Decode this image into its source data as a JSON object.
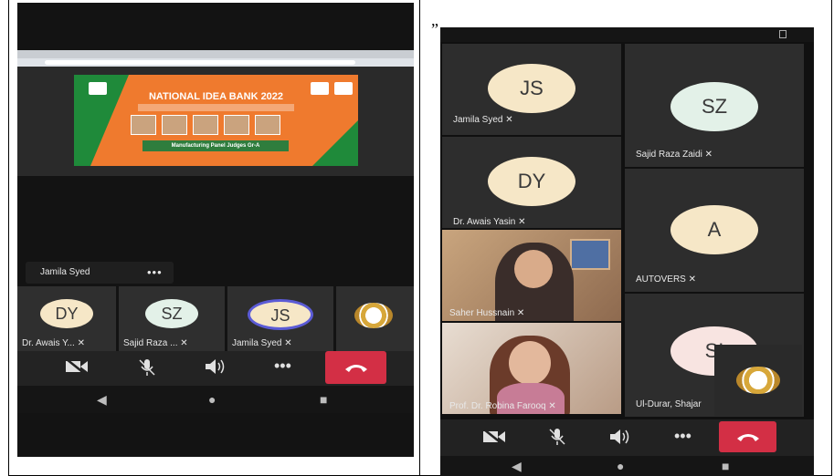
{
  "caption_mark": "„",
  "left_phone": {
    "slide": {
      "title": "NATIONAL IDEA BANK 2022",
      "panel_label": "Manufacturing Panel Judges Gr-A"
    },
    "pinned_name": "Jamila Syed",
    "more_label": "•••",
    "participants": [
      {
        "initials": "DY",
        "label": "Dr. Awais Y... ✕"
      },
      {
        "initials": "SZ",
        "label": "Sajid Raza ... ✕"
      },
      {
        "initials": "JS",
        "label": "Jamila Syed ✕"
      }
    ],
    "controls": [
      "camera-off",
      "mic-off",
      "speaker",
      "more",
      "hang-up"
    ],
    "more_dots": "•••",
    "nav": {
      "back": "◀",
      "home": "●",
      "recent": "■"
    }
  },
  "right_phone": {
    "tiles": [
      {
        "initials": "JS",
        "label": "Jamila Syed ✕"
      },
      {
        "initials": "SZ",
        "label": "Sajid Raza Zaidi ✕"
      },
      {
        "initials": "DY",
        "label": "Dr. Awais Yasin ✕"
      },
      {
        "initials": "A",
        "label": "AUTOVERS ✕"
      },
      {
        "label": "Saher Hussnain ✕"
      },
      {
        "initials": "SI",
        "label": "Ul-Durar, Shajar"
      },
      {
        "label": "Prof. Dr. Robina Farooq ✕"
      }
    ],
    "more_dots": "•••",
    "nav": {
      "back": "◀",
      "home": "●",
      "recent": "■"
    }
  },
  "colors": {
    "avatar_bg": "#f6e7c7",
    "hangup": "#d32f45",
    "slide_orange": "#ef7a2e",
    "slide_green": "#1f8a3a"
  }
}
